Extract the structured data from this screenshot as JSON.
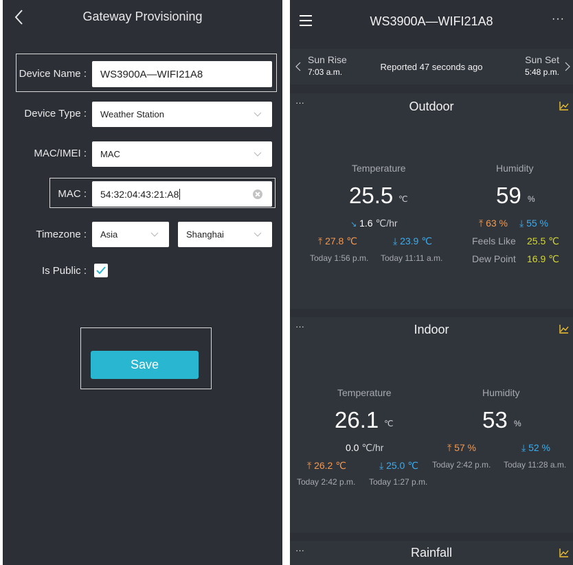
{
  "provisioning": {
    "title": "Gateway Provisioning",
    "device_name": {
      "label": "Device Name :",
      "value": "WS3900A—WIFI21A8"
    },
    "device_type": {
      "label": "Device Type :",
      "value": "Weather Station"
    },
    "mac_imei": {
      "label": "MAC/IMEI :",
      "value": "MAC"
    },
    "mac": {
      "label": "MAC :",
      "value": "54:32:04:43:21:A8"
    },
    "timezone": {
      "label": "Timezone :",
      "region": "Asia",
      "city": "Shanghai"
    },
    "is_public": {
      "label": "Is Public :",
      "checked": true
    },
    "save_label": "Save"
  },
  "dashboard": {
    "title": "WS3900A—WIFI21A8",
    "more": "···",
    "sun_rise_label": "Sun Rise",
    "sun_rise_time": "7:03 a.m.",
    "reported": "Reported 47 seconds ago",
    "sun_set_label": "Sun Set",
    "sun_set_time": "5:48 p.m.",
    "outdoor": {
      "title": "Outdoor",
      "dots": "···",
      "temperature_label": "Temperature",
      "temperature": "25.5",
      "temp_unit": "℃",
      "rate": "1.6",
      "rate_unit": "℃/hr",
      "temp_high": "27.8 ℃",
      "temp_low": "23.9 ℃",
      "temp_high_time": "Today 1:56 p.m.",
      "temp_low_time": "Today 11:11 a.m.",
      "humidity_label": "Humidity",
      "humidity": "59",
      "humidity_unit": "%",
      "hum_high": "63 %",
      "hum_low": "55 %",
      "feels_like_label": "Feels Like",
      "feels_like": "25.5 ℃",
      "dew_point_label": "Dew Point",
      "dew_point": "16.9 ℃"
    },
    "indoor": {
      "title": "Indoor",
      "dots": "···",
      "temperature_label": "Temperature",
      "temperature": "26.1",
      "temp_unit": "℃",
      "rate": "0.0",
      "rate_unit": "℃/hr",
      "temp_high": "26.2 ℃",
      "temp_low": "25.0 ℃",
      "temp_high_time": "Today 2:42 p.m.",
      "temp_low_time": "Today 1:27 p.m.",
      "humidity_label": "Humidity",
      "humidity": "53",
      "humidity_unit": "%",
      "hum_high": "57 %",
      "hum_low": "52 %",
      "hum_high_time": "Today 2:42 p.m.",
      "hum_low_time": "Today 11:28 a.m."
    },
    "rainfall": {
      "title": "Rainfall",
      "dots": "···"
    }
  }
}
